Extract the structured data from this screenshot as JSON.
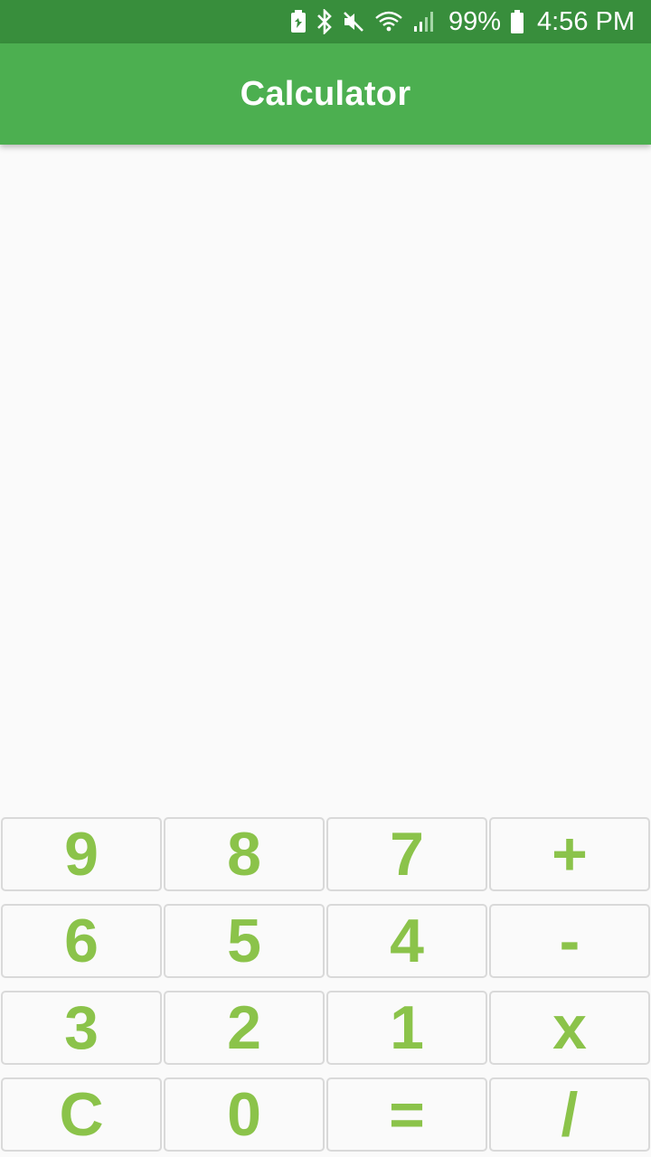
{
  "status_bar": {
    "battery_percent": "99%",
    "time": "4:56 PM",
    "icons": [
      "battery-saver-icon",
      "bluetooth-icon",
      "mute-icon",
      "wifi-icon",
      "signal-icon",
      "battery-icon"
    ]
  },
  "app_bar": {
    "title": "Calculator"
  },
  "keypad": {
    "keys": [
      "9",
      "8",
      "7",
      "+",
      "6",
      "5",
      "4",
      "-",
      "3",
      "2",
      "1",
      "x",
      "C",
      "0",
      "=",
      "/"
    ]
  },
  "colors": {
    "status_bar": "#388e3c",
    "app_bar": "#4caf50",
    "key_text": "#8bc34a",
    "key_border": "#d9d9d9",
    "background": "#fafafa"
  }
}
